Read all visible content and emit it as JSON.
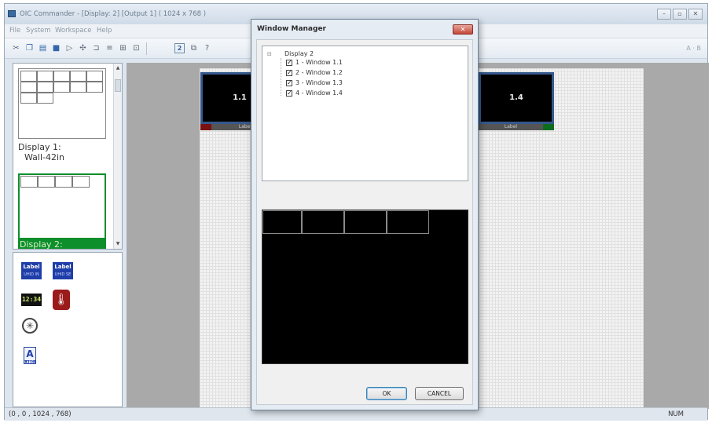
{
  "app": {
    "title": "OIC Commander - [Display: 2] [Output 1] ( 1024 x 768 )",
    "window_controls": [
      "–",
      "▫",
      "✕"
    ]
  },
  "menu": [
    "File",
    "System",
    "Workspace",
    "Help"
  ],
  "toolbar": {
    "page_number": "2",
    "right_text": "A · B"
  },
  "displays": [
    {
      "label": "Display 1:",
      "sublabel": "Wall-42in"
    },
    {
      "label": "Display 2:"
    }
  ],
  "widgets": {
    "label_a": {
      "text": "Label",
      "sub": "UHID IN"
    },
    "label_b": {
      "text": "Label",
      "sub": "UHID SE"
    },
    "clock": "12:34",
    "temperature_icon": "thermometer-icon",
    "analog_clock_icon": "clock-face-icon",
    "text_widget": {
      "text": "A",
      "sub": "LABEL"
    }
  },
  "canvas": {
    "windows": [
      {
        "label": "1.1",
        "strip_label": "Label",
        "marker_color": "#7a1010"
      },
      {
        "label": "1.4",
        "strip_label": "Label",
        "marker_color": "#0d6d1f"
      }
    ]
  },
  "status": {
    "coords": "(0 , 0 , 1024 , 768)",
    "num": "NUM"
  },
  "dialog": {
    "title": "Window Manager",
    "close": "✕",
    "tree_expander": "⊟",
    "tree_root": "Display  2",
    "items": [
      {
        "label": "1 - Window 1.1",
        "checked": "✓"
      },
      {
        "label": "2 - Window 1.2",
        "checked": "✓"
      },
      {
        "label": "3 - Window 1.3",
        "checked": "✓"
      },
      {
        "label": "4 - Window 1.4",
        "checked": "✓"
      }
    ],
    "ok_label": "OK",
    "cancel_label": "CANCEL"
  }
}
